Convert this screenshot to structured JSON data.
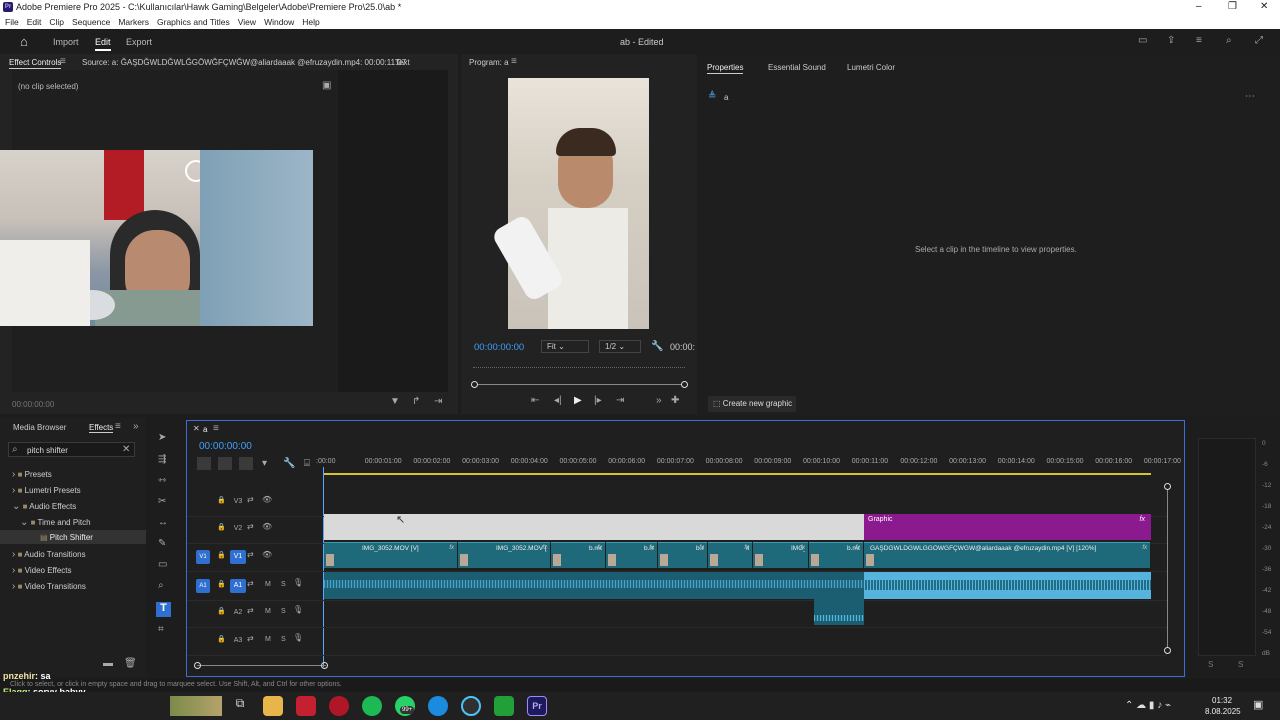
{
  "window": {
    "title": "Adobe Premiere Pro 2025 - C:\\Kullanıcılar\\Hawk Gaming\\Belgeler\\Adobe\\Premiere Pro\\25.0\\ab *",
    "controls": [
      "–",
      "❐",
      "✕"
    ]
  },
  "menu": [
    "File",
    "Edit",
    "Clip",
    "Sequence",
    "Markers",
    "Graphics and Titles",
    "View",
    "Window",
    "Help"
  ],
  "topbar": {
    "tabs": [
      "Import",
      "Edit",
      "Export"
    ],
    "project": "ab - Edited"
  },
  "source_panel": {
    "tabs": [
      "Effect Controls",
      "Source: a: ĞAŞDĞWLDĞWLĞGÖWĞFÇWĞW@aliardaaak @efruzaydin.mp4: 00:00:11:07",
      "Text"
    ],
    "no_clip": "(no clip selected)",
    "timecode": "00:00:00:00"
  },
  "program": {
    "label": "Program: a",
    "timecode": "00:00:00:00",
    "fit": "Fit",
    "res": "1/2",
    "right_tc": "00:00:"
  },
  "properties": {
    "tabs": [
      "Properties",
      "Essential Sound",
      "Lumetri Color"
    ],
    "item": "a",
    "message": "Select a clip in the timeline to view properties.",
    "create": "Create new graphic"
  },
  "effects": {
    "tabs": [
      "Media Browser",
      "Effects"
    ],
    "search": "pitch shifter",
    "tree": [
      "Presets",
      "Lumetri Presets",
      "Audio Effects",
      "Time and Pitch",
      "Pitch Shifter",
      "Audio Transitions",
      "Video Effects",
      "Video Transitions"
    ]
  },
  "timeline": {
    "name": "a",
    "timecode": "00:00:00:00",
    "ruler": [
      ":00:00",
      "00:00:01:00",
      "00:00:02:00",
      "00:00:03:00",
      "00:00:04:00",
      "00:00:05:00",
      "00:00:06:00",
      "00:00:07:00",
      "00:00:08:00",
      "00:00:09:00",
      "00:00:10:00",
      "00:00:11:00",
      "00:00:12:00",
      "00:00:13:00",
      "00:00:14:00",
      "00:00:15:00",
      "00:00:16:00",
      "00:00:17:00"
    ],
    "tracks": [
      "V3",
      "V2",
      "V1",
      "A1",
      "A2",
      "A3"
    ],
    "graphic_label": "Graphic",
    "v1_clips": [
      "IMG_3052.MOV [V]",
      "IMG_3052.MOV [V]",
      "b.mov...",
      "b.mov...",
      "b.mo...",
      "IM...",
      "IMG_3...",
      "b.mov...",
      "ĞAŞDĞWLDĞWLĞGÖWĞFÇWĞW@aliardaaak @efruzaydin.mp4 [V] [120%]"
    ],
    "fx": "fx",
    "m": "M",
    "s": "S"
  },
  "meter": {
    "ticks": [
      "0",
      "-6",
      "-12",
      "-18",
      "-24",
      "-30",
      "-36",
      "-42",
      "-48",
      "-54",
      "dB"
    ],
    "bottom": [
      "S",
      "S"
    ]
  },
  "status": "Click to select, or click in empty space and drag to marquee select. Use Shift, Alt, and Ctrl for other options.",
  "chat": [
    {
      "user": "pnzehir",
      "msg": ": sa"
    },
    {
      "user": "Elaqq",
      "msg": ": soryy babyy"
    }
  ],
  "taskbar": {
    "time": "01:32",
    "date": "8.08.2025",
    "badge": "99+"
  }
}
